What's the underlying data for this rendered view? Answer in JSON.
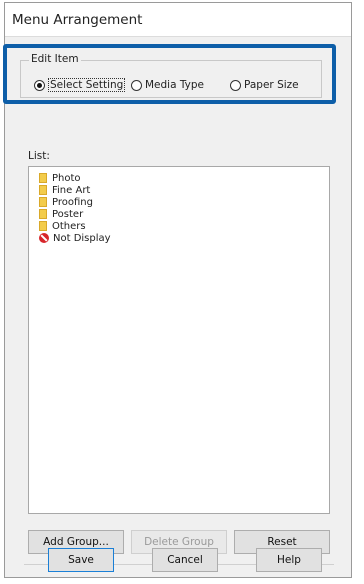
{
  "window": {
    "title": "Menu Arrangement"
  },
  "edit_item": {
    "legend": "Edit Item",
    "options": [
      {
        "label": "Select Setting",
        "checked": true
      },
      {
        "label": "Media Type",
        "checked": false
      },
      {
        "label": "Paper Size",
        "checked": false
      }
    ]
  },
  "list": {
    "label": "List:",
    "items": [
      {
        "label": "Photo",
        "icon": "folder-icon"
      },
      {
        "label": "Fine Art",
        "icon": "folder-icon"
      },
      {
        "label": "Proofing",
        "icon": "folder-icon"
      },
      {
        "label": "Poster",
        "icon": "folder-icon"
      },
      {
        "label": "Others",
        "icon": "folder-icon"
      },
      {
        "label": "Not Display",
        "icon": "not-display-icon"
      }
    ]
  },
  "group_buttons": {
    "add": "Add Group...",
    "delete": "Delete Group",
    "reset": "Reset"
  },
  "footer_buttons": {
    "save": "Save",
    "cancel": "Cancel",
    "help": "Help"
  },
  "colors": {
    "highlight": "#0d5ea8",
    "folder": "#f3cc4b",
    "not_display": "#d7262a"
  }
}
